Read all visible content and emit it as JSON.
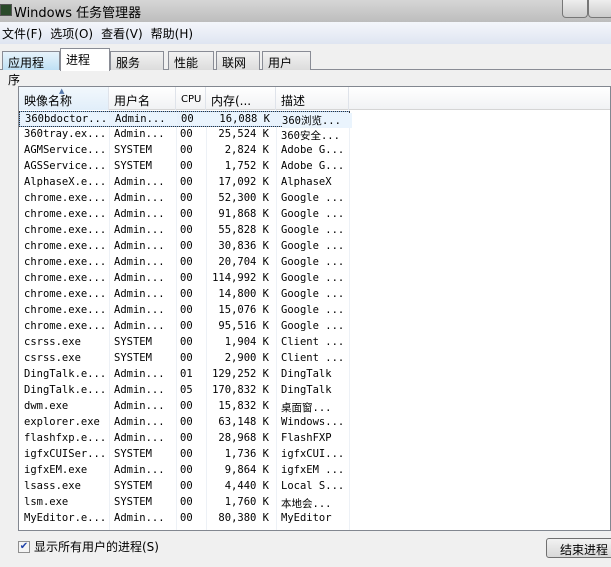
{
  "window": {
    "title": "Windows 任务管理器"
  },
  "menu": [
    "文件(F)",
    "选项(O)",
    "查看(V)",
    "帮助(H)"
  ],
  "tabs": [
    "应用程序",
    "进程",
    "服务",
    "性能",
    "联网",
    "用户"
  ],
  "columns": [
    "映像名称",
    "用户名",
    "CPU",
    "内存(...",
    "描述"
  ],
  "rows": [
    [
      "360bdoctor...",
      "Admin...",
      "00",
      "16,088 K",
      "360浏览..."
    ],
    [
      "360tray.ex...",
      "Admin...",
      "00",
      "25,524 K",
      "360安全..."
    ],
    [
      "AGMService...",
      "SYSTEM",
      "00",
      "2,824 K",
      "Adobe G..."
    ],
    [
      "AGSService...",
      "SYSTEM",
      "00",
      "1,752 K",
      "Adobe G..."
    ],
    [
      "AlphaseX.e...",
      "Admin...",
      "00",
      "17,092 K",
      "AlphaseX"
    ],
    [
      "chrome.exe...",
      "Admin...",
      "00",
      "52,300 K",
      "Google ..."
    ],
    [
      "chrome.exe...",
      "Admin...",
      "00",
      "91,868 K",
      "Google ..."
    ],
    [
      "chrome.exe...",
      "Admin...",
      "00",
      "55,828 K",
      "Google ..."
    ],
    [
      "chrome.exe...",
      "Admin...",
      "00",
      "30,836 K",
      "Google ..."
    ],
    [
      "chrome.exe...",
      "Admin...",
      "00",
      "20,704 K",
      "Google ..."
    ],
    [
      "chrome.exe...",
      "Admin...",
      "00",
      "114,992 K",
      "Google ..."
    ],
    [
      "chrome.exe...",
      "Admin...",
      "00",
      "14,800 K",
      "Google ..."
    ],
    [
      "chrome.exe...",
      "Admin...",
      "00",
      "15,076 K",
      "Google ..."
    ],
    [
      "chrome.exe...",
      "Admin...",
      "00",
      "95,516 K",
      "Google ..."
    ],
    [
      "csrss.exe",
      "SYSTEM",
      "00",
      "1,904 K",
      "Client ..."
    ],
    [
      "csrss.exe",
      "SYSTEM",
      "00",
      "2,900 K",
      "Client ..."
    ],
    [
      "DingTalk.e...",
      "Admin...",
      "01",
      "129,252 K",
      "DingTalk"
    ],
    [
      "DingTalk.e...",
      "Admin...",
      "05",
      "170,832 K",
      "DingTalk"
    ],
    [
      "dwm.exe",
      "Admin...",
      "00",
      "15,832 K",
      "桌面窗..."
    ],
    [
      "explorer.exe",
      "Admin...",
      "00",
      "63,148 K",
      "Windows..."
    ],
    [
      "flashfxp.e...",
      "Admin...",
      "00",
      "28,968 K",
      "FlashFXP"
    ],
    [
      "igfxCUISer...",
      "SYSTEM",
      "00",
      "1,736 K",
      "igfxCUI..."
    ],
    [
      "igfxEM.exe",
      "Admin...",
      "00",
      "9,864 K",
      "igfxEM ..."
    ],
    [
      "lsass.exe",
      "SYSTEM",
      "00",
      "4,440 K",
      "Local S..."
    ],
    [
      "lsm.exe",
      "SYSTEM",
      "00",
      "1,760 K",
      "本地会..."
    ],
    [
      "MyEditor.e...",
      "Admin...",
      "00",
      "80,380 K",
      "MyEditor"
    ]
  ],
  "show_all_users": {
    "label": "显示所有用户的进程(S)",
    "checked": true
  },
  "end_process_label": "结束进程"
}
